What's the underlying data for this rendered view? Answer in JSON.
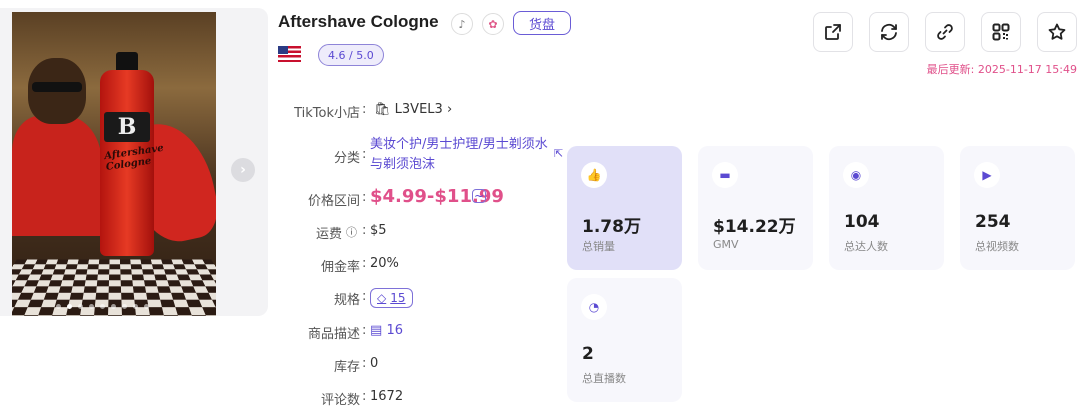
{
  "product": {
    "title": "Aftershave Cologne",
    "badge": "货盘",
    "rating": "4.6 / 5.0",
    "country_flag": "us-flag-icon"
  },
  "gallery": {
    "bottle_brand": "B",
    "bottle_text": "Aftershave Cologne",
    "dot_count": 9,
    "active_dot": 2
  },
  "actions": [
    {
      "name": "share-button",
      "icon": "share-icon",
      "glyph": "⇱"
    },
    {
      "name": "refresh-button",
      "icon": "refresh-icon",
      "glyph": "⟳"
    },
    {
      "name": "link-button",
      "icon": "link-icon",
      "glyph": "🔗"
    },
    {
      "name": "qr-button",
      "icon": "qr-code-icon",
      "glyph": "▦"
    },
    {
      "name": "favorite-button",
      "icon": "star-icon",
      "glyph": "☆"
    }
  ],
  "last_updated": "最后更新: 2025-11-17 15:49",
  "info": {
    "shop_label": "TikTok小店",
    "shop_name": "L3VEL3",
    "category_label": "分类",
    "category_value": "美妆个护/男士护理/男士剃须水与剃须泡沫",
    "price_label": "价格区间",
    "price_value": "$4.99-$11.99",
    "shipping_label": "运费",
    "shipping_value": "$5",
    "commission_label": "佣金率",
    "commission_value": "20%",
    "spec_label": "规格",
    "spec_value": "15",
    "desc_label": "商品描述",
    "desc_value": "16",
    "stock_label": "库存",
    "stock_value": "0",
    "reviews_label": "评论数",
    "reviews_value": "1672"
  },
  "stats": [
    {
      "value": "1.78万",
      "label": "总销量",
      "icon": "thumbs-up-icon",
      "highlight": true
    },
    {
      "value": "$14.22万",
      "label": "GMV",
      "icon": "wallet-icon",
      "highlight": false
    },
    {
      "value": "104",
      "label": "总达人数",
      "icon": "influencer-icon",
      "highlight": false
    },
    {
      "value": "254",
      "label": "总视频数",
      "icon": "video-icon",
      "highlight": false
    },
    {
      "value": "2",
      "label": "总直播数",
      "icon": "live-icon",
      "highlight": false
    }
  ],
  "colors": {
    "accent": "#5b4ad2",
    "price": "#e0508a",
    "card_highlight": "#e1e0f8",
    "card_bg": "#f7f7fc"
  }
}
